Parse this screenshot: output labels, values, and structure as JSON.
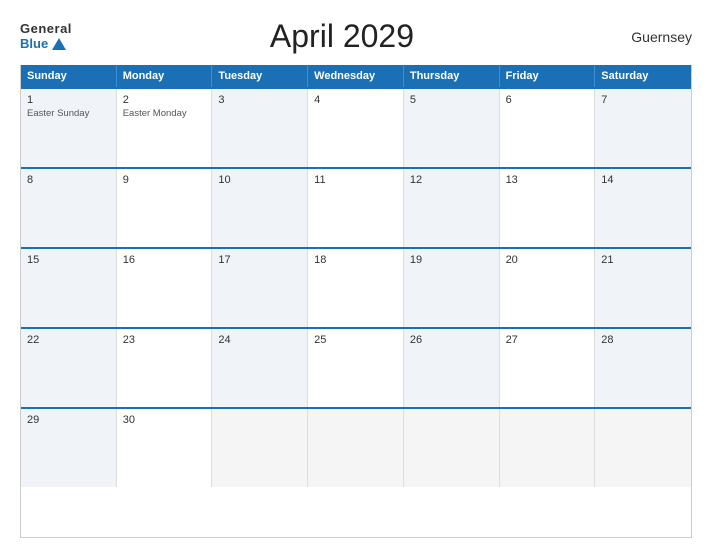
{
  "header": {
    "logo_general": "General",
    "logo_blue": "Blue",
    "title": "April 2029",
    "region": "Guernsey"
  },
  "calendar": {
    "headers": [
      "Sunday",
      "Monday",
      "Tuesday",
      "Wednesday",
      "Thursday",
      "Friday",
      "Saturday"
    ],
    "weeks": [
      [
        {
          "day": "1",
          "holiday": "Easter Sunday",
          "empty": false
        },
        {
          "day": "2",
          "holiday": "Easter Monday",
          "empty": false
        },
        {
          "day": "3",
          "holiday": "",
          "empty": false
        },
        {
          "day": "4",
          "holiday": "",
          "empty": false
        },
        {
          "day": "5",
          "holiday": "",
          "empty": false
        },
        {
          "day": "6",
          "holiday": "",
          "empty": false
        },
        {
          "day": "7",
          "holiday": "",
          "empty": false
        }
      ],
      [
        {
          "day": "8",
          "holiday": "",
          "empty": false
        },
        {
          "day": "9",
          "holiday": "",
          "empty": false
        },
        {
          "day": "10",
          "holiday": "",
          "empty": false
        },
        {
          "day": "11",
          "holiday": "",
          "empty": false
        },
        {
          "day": "12",
          "holiday": "",
          "empty": false
        },
        {
          "day": "13",
          "holiday": "",
          "empty": false
        },
        {
          "day": "14",
          "holiday": "",
          "empty": false
        }
      ],
      [
        {
          "day": "15",
          "holiday": "",
          "empty": false
        },
        {
          "day": "16",
          "holiday": "",
          "empty": false
        },
        {
          "day": "17",
          "holiday": "",
          "empty": false
        },
        {
          "day": "18",
          "holiday": "",
          "empty": false
        },
        {
          "day": "19",
          "holiday": "",
          "empty": false
        },
        {
          "day": "20",
          "holiday": "",
          "empty": false
        },
        {
          "day": "21",
          "holiday": "",
          "empty": false
        }
      ],
      [
        {
          "day": "22",
          "holiday": "",
          "empty": false
        },
        {
          "day": "23",
          "holiday": "",
          "empty": false
        },
        {
          "day": "24",
          "holiday": "",
          "empty": false
        },
        {
          "day": "25",
          "holiday": "",
          "empty": false
        },
        {
          "day": "26",
          "holiday": "",
          "empty": false
        },
        {
          "day": "27",
          "holiday": "",
          "empty": false
        },
        {
          "day": "28",
          "holiday": "",
          "empty": false
        }
      ],
      [
        {
          "day": "29",
          "holiday": "",
          "empty": false
        },
        {
          "day": "30",
          "holiday": "",
          "empty": false
        },
        {
          "day": "",
          "holiday": "",
          "empty": true
        },
        {
          "day": "",
          "holiday": "",
          "empty": true
        },
        {
          "day": "",
          "holiday": "",
          "empty": true
        },
        {
          "day": "",
          "holiday": "",
          "empty": true
        },
        {
          "day": "",
          "holiday": "",
          "empty": true
        }
      ]
    ]
  }
}
